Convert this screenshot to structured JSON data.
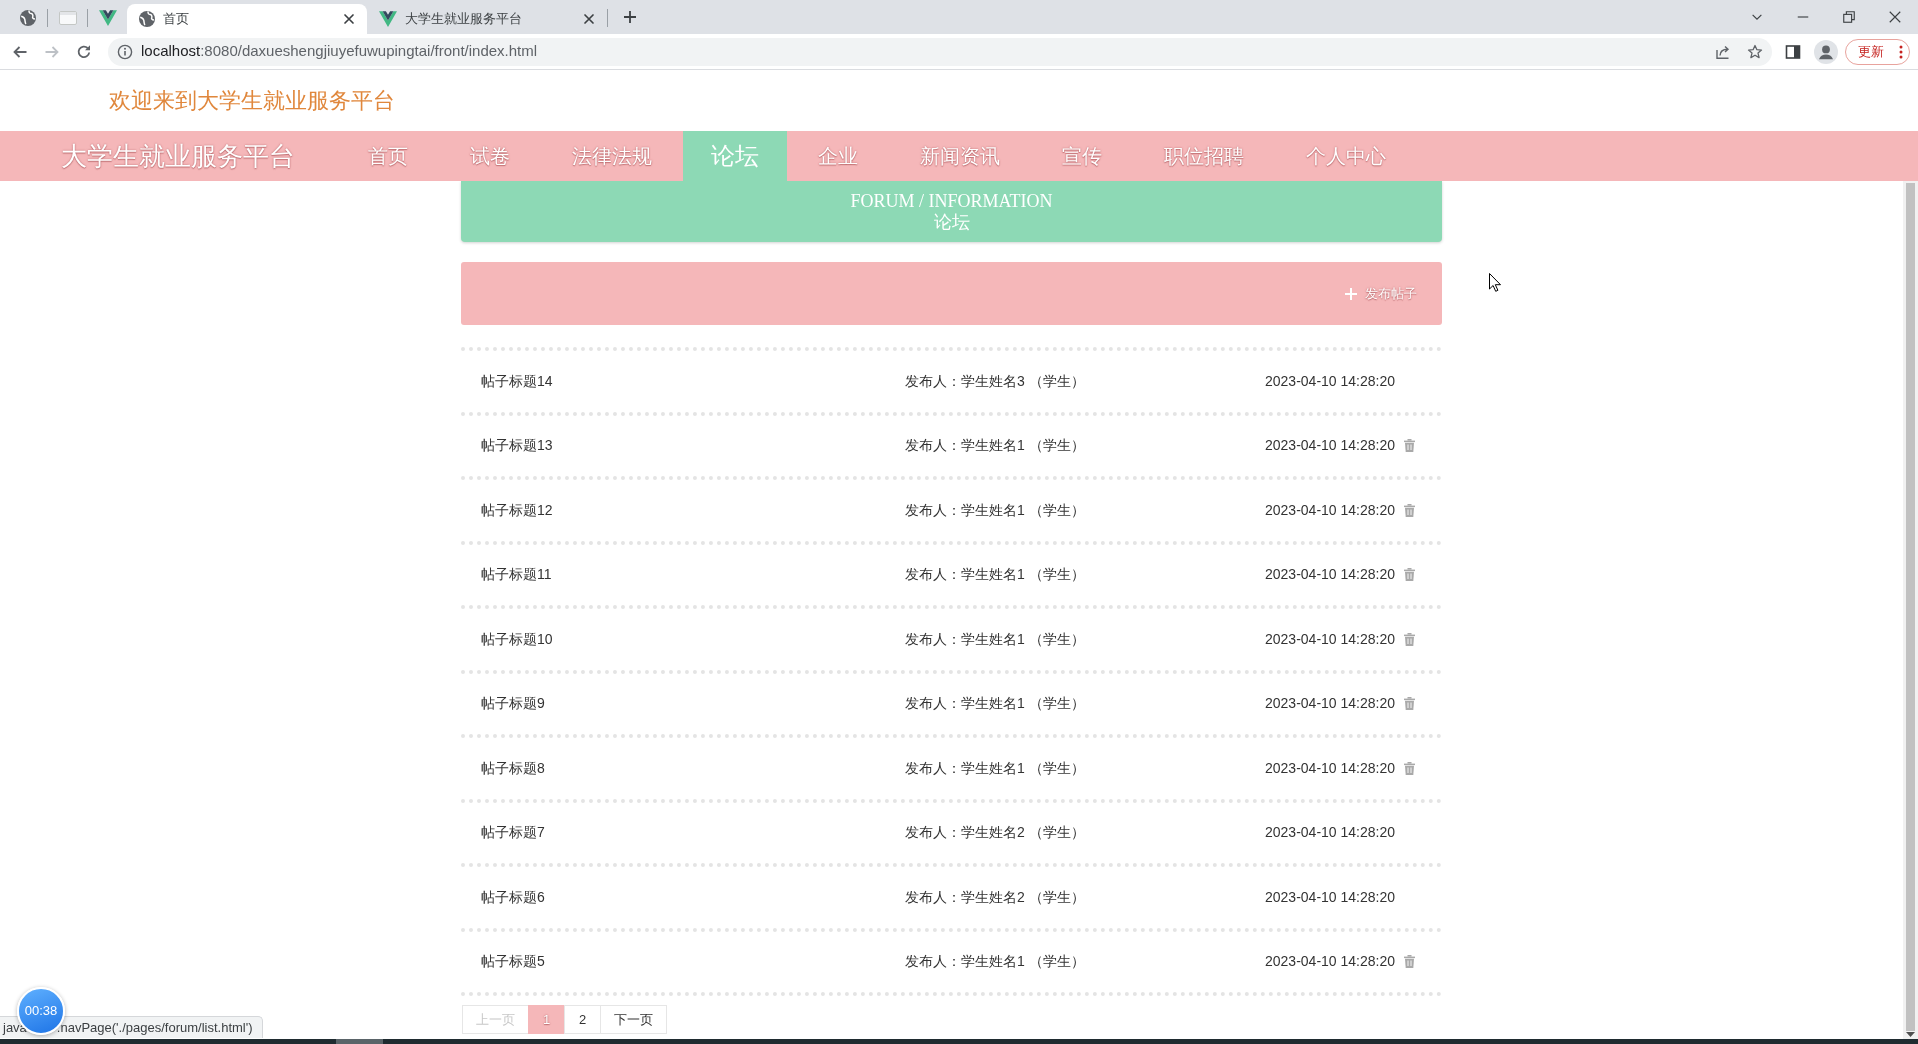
{
  "browser": {
    "tabs": [
      {
        "kind": "pinned",
        "selected": false
      },
      {
        "kind": "pinned",
        "selected": false
      },
      {
        "kind": "pinned",
        "selected": false
      },
      {
        "kind": "page",
        "title": "首页",
        "selected": true
      },
      {
        "kind": "page",
        "title": "大学生就业服务平台",
        "selected": false
      }
    ],
    "address": {
      "host": "localhost",
      "path": ":8080/daxueshengjiuyefuwupingtai/front/index.html"
    },
    "update_button": "更新"
  },
  "header": {
    "welcome": "欢迎来到大学生就业服务平台"
  },
  "nav": {
    "brand": "大学生就业服务平台",
    "items": [
      {
        "label": "首页",
        "selected": false
      },
      {
        "label": "试卷",
        "selected": false
      },
      {
        "label": "法律法规",
        "selected": false
      },
      {
        "label": "论坛",
        "selected": true
      },
      {
        "label": "企业",
        "selected": false
      },
      {
        "label": "新闻资讯",
        "selected": false
      },
      {
        "label": "宣传",
        "selected": false
      },
      {
        "label": "职位招聘",
        "selected": false
      },
      {
        "label": "个人中心",
        "selected": false
      }
    ]
  },
  "banner": {
    "title_en": "FORUM / INFORMATION",
    "title": "论坛"
  },
  "toolbar": {
    "post_button": "发布帖子"
  },
  "posts": [
    {
      "title": "帖子标题14",
      "author": "发布人：学生姓名3 （学生）",
      "time": "2023-04-10 14:28:20",
      "deletable": false
    },
    {
      "title": "帖子标题13",
      "author": "发布人：学生姓名1 （学生）",
      "time": "2023-04-10 14:28:20",
      "deletable": true
    },
    {
      "title": "帖子标题12",
      "author": "发布人：学生姓名1 （学生）",
      "time": "2023-04-10 14:28:20",
      "deletable": true
    },
    {
      "title": "帖子标题11",
      "author": "发布人：学生姓名1 （学生）",
      "time": "2023-04-10 14:28:20",
      "deletable": true
    },
    {
      "title": "帖子标题10",
      "author": "发布人：学生姓名1 （学生）",
      "time": "2023-04-10 14:28:20",
      "deletable": true
    },
    {
      "title": "帖子标题9",
      "author": "发布人：学生姓名1 （学生）",
      "time": "2023-04-10 14:28:20",
      "deletable": true
    },
    {
      "title": "帖子标题8",
      "author": "发布人：学生姓名1 （学生）",
      "time": "2023-04-10 14:28:20",
      "deletable": true
    },
    {
      "title": "帖子标题7",
      "author": "发布人：学生姓名2 （学生）",
      "time": "2023-04-10 14:28:20",
      "deletable": false
    },
    {
      "title": "帖子标题6",
      "author": "发布人：学生姓名2 （学生）",
      "time": "2023-04-10 14:28:20",
      "deletable": false
    },
    {
      "title": "帖子标题5",
      "author": "发布人：学生姓名1 （学生）",
      "time": "2023-04-10 14:28:20",
      "deletable": true
    }
  ],
  "pagination": [
    {
      "kind": "prev",
      "label": "上一页",
      "selected": false,
      "disabled": true
    },
    {
      "kind": "page",
      "label": "1",
      "selected": true,
      "disabled": false
    },
    {
      "kind": "page",
      "label": "2",
      "selected": false,
      "disabled": false
    },
    {
      "kind": "next",
      "label": "下一页",
      "selected": false,
      "disabled": false
    }
  ],
  "status_bar": {
    "text_start": "java",
    "text_end": ".navPage('./pages/forum/list.html')"
  },
  "timer": "00:38"
}
